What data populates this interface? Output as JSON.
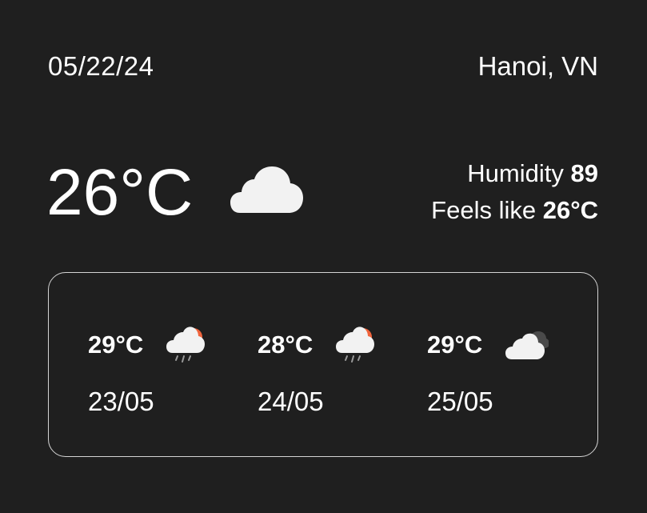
{
  "header": {
    "date": "05/22/24",
    "location": "Hanoi, VN"
  },
  "current": {
    "temperature": "26°C",
    "icon": "cloud-icon",
    "humidity_label": "Humidity",
    "humidity_value": "89",
    "feels_like_label": "Feels like",
    "feels_like_value": "26°C"
  },
  "forecast": [
    {
      "temperature": "29°C",
      "date": "23/05",
      "icon": "sun-cloud-rain-icon"
    },
    {
      "temperature": "28°C",
      "date": "24/05",
      "icon": "sun-cloud-rain-icon"
    },
    {
      "temperature": "29°C",
      "date": "25/05",
      "icon": "clouds-icon"
    }
  ],
  "colors": {
    "background": "#1f1f1f",
    "text": "#ffffff",
    "cloud": "#f2f2f2",
    "sun": "#f0643c",
    "rain": "#9a9a9a",
    "dark_cloud": "#4a4a4a"
  }
}
